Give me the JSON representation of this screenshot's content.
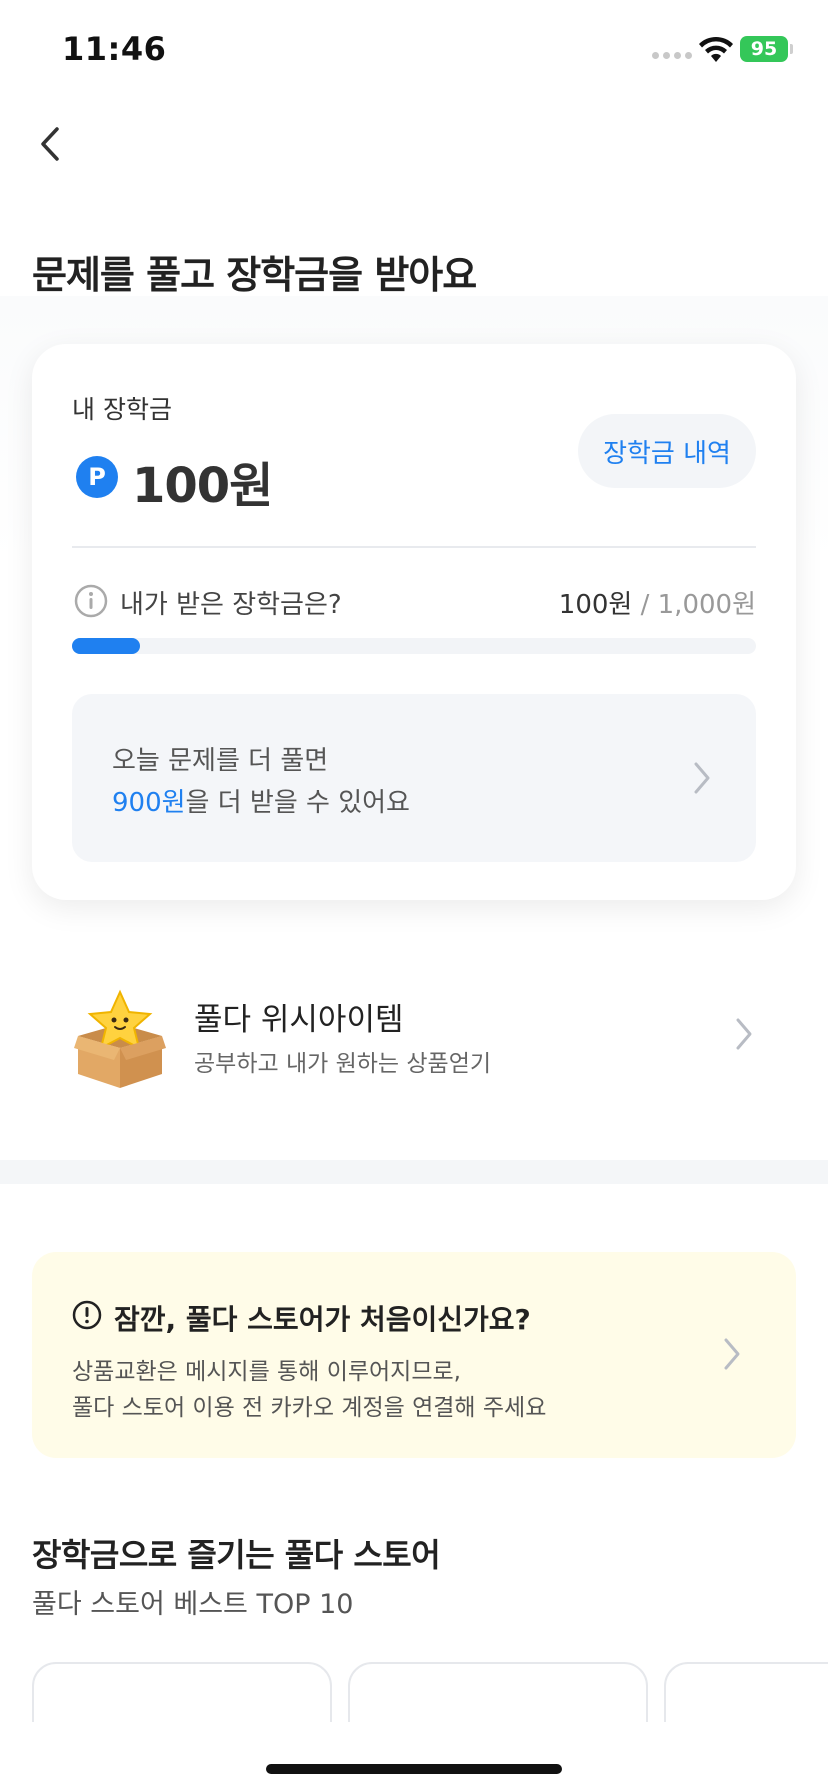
{
  "status_bar": {
    "time": "11:46",
    "battery": "95"
  },
  "header": {
    "title": "문제를 풀고 장학금을 받아요"
  },
  "scholarship_card": {
    "label": "내 장학금",
    "point_symbol": "P",
    "amount": "100원",
    "history_button": "장학금 내역",
    "received_label": "내가 받은 장학금은?",
    "progress_current": "100원",
    "progress_separator": " / ",
    "progress_total": "1,000원",
    "progress_fraction": 0.1,
    "tip_line1": "오늘 문제를 더 풀면",
    "tip_amount": "900원",
    "tip_line2_rest": "을 더 받을 수 있어요"
  },
  "wish_item": {
    "title": "풀다 위시아이템",
    "subtitle": "공부하고 내가 원하는 상품얻기",
    "icon": "star-in-box-icon"
  },
  "notice": {
    "title": "잠깐, 풀다 스토어가 처음이신가요?",
    "line1": "상품교환은 메시지를 통해 이루어지므로,",
    "line2": "풀다 스토어 이용 전 카카오 계정을 연결해 주세요",
    "background": "#fffce8"
  },
  "store": {
    "title": "장학금으로 즐기는 풀다 스토어",
    "subtitle": "풀다 스토어 베스트 TOP 10"
  },
  "colors": {
    "accent": "#1f80f0",
    "battery": "#34c759"
  }
}
